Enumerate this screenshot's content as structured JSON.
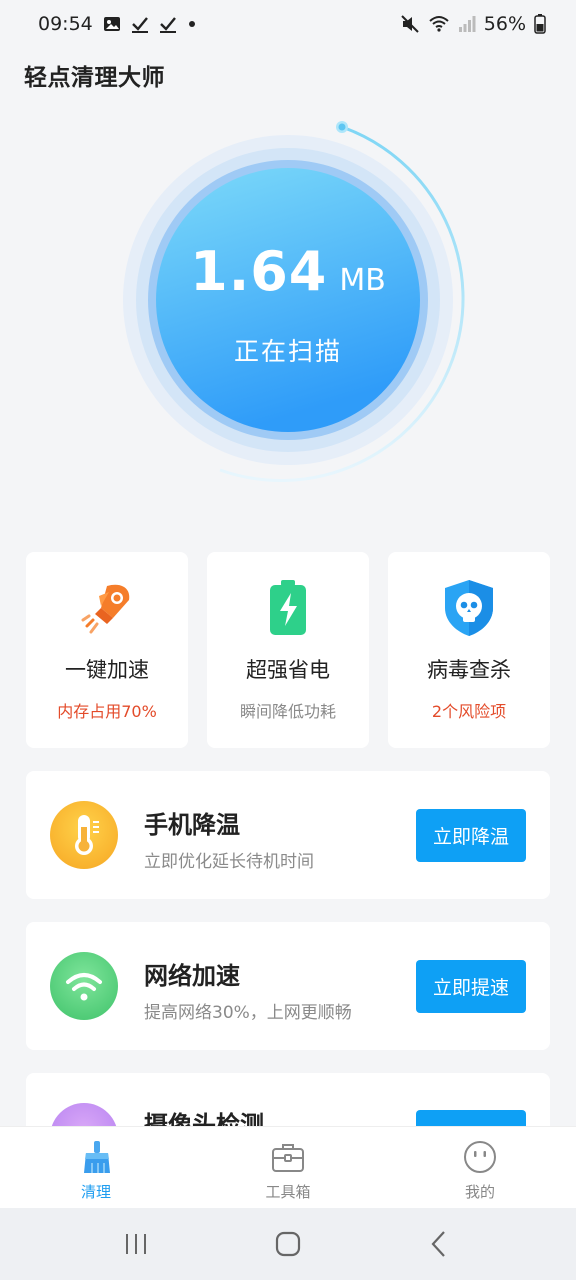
{
  "status_bar": {
    "time": "09:54",
    "battery_percent": "56%",
    "left_icons": [
      "image-icon",
      "check-icon",
      "check-icon",
      "dot-icon"
    ],
    "right_icons": [
      "mute-icon",
      "wifi-icon",
      "signal-icon",
      "battery-icon"
    ]
  },
  "app": {
    "title": "轻点清理大师"
  },
  "scan": {
    "value": "1.64",
    "unit": "MB",
    "status": "正在扫描"
  },
  "features": [
    {
      "icon": "rocket-icon",
      "title": "一键加速",
      "subtitle": "内存占用70%",
      "subtitle_color": "#e34b2a"
    },
    {
      "icon": "battery-bolt-icon",
      "title": "超强省电",
      "subtitle": "瞬间降低功耗",
      "subtitle_color": "#8a8a8a"
    },
    {
      "icon": "virus-shield-icon",
      "title": "病毒查杀",
      "subtitle": "2个风险项",
      "subtitle_color": "#e34b2a"
    }
  ],
  "list": [
    {
      "icon": "thermometer-icon",
      "title": "手机降温",
      "subtitle": "立即优化延长待机时间",
      "button": "立即降温"
    },
    {
      "icon": "wifi-icon",
      "title": "网络加速",
      "subtitle": "提高网络30%，上网更顺畅",
      "button": "立即提速"
    },
    {
      "icon": "camera-icon",
      "title": "摄像头检测",
      "subtitle": "",
      "button": ""
    }
  ],
  "bottom_nav": [
    {
      "icon": "broom-icon",
      "label": "清理",
      "active": true
    },
    {
      "icon": "toolbox-icon",
      "label": "工具箱",
      "active": false
    },
    {
      "icon": "face-icon",
      "label": "我的",
      "active": false
    }
  ],
  "colors": {
    "accent": "#1e9df0",
    "button": "#0ea0f5",
    "warning": "#e34b2a"
  }
}
